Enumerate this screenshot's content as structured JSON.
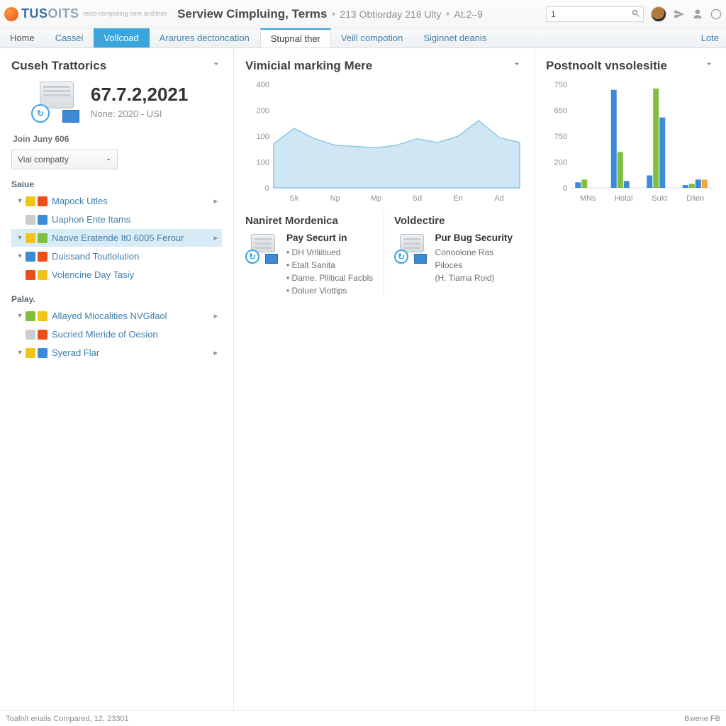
{
  "brand": {
    "part1": "TUS",
    "part2": "OITS",
    "subtitle": "telco computing nsm acdtines"
  },
  "breadcrumb": {
    "main": "Serview Cimpluing, Terms",
    "meta1": "213 Obtiorday 218 Ulty",
    "meta2": "At.2–9"
  },
  "search": {
    "value": "1"
  },
  "nav": {
    "items": [
      {
        "label": "Home"
      },
      {
        "label": "Cassel"
      },
      {
        "label": "Vollcoad"
      },
      {
        "label": "Ararures dectoncation"
      },
      {
        "label": "Stupnal ther"
      },
      {
        "label": "Veill compotion"
      },
      {
        "label": "Siginnet deanis"
      }
    ],
    "right": "Lote"
  },
  "left": {
    "title": "Cuseh Trattorics",
    "hero_number": "67.7.2,2021",
    "hero_sub": "None: 2020 - USI",
    "meta": "Join Juny 606",
    "select_value": "Vial compatty",
    "groups": [
      {
        "label": "Saiue",
        "items": [
          {
            "label": "Mapock Utles",
            "caret": true,
            "selected": false,
            "chev": true
          },
          {
            "label": "Uaphon Ente Itams",
            "caret": false,
            "selected": false,
            "chev": false
          },
          {
            "label": "Naove Eratende It0 6005 Ferour",
            "caret": true,
            "selected": true,
            "chev": true
          },
          {
            "label": "Duissand Toutlolution",
            "caret": true,
            "selected": false,
            "chev": false
          },
          {
            "label": "Volencine Day Tasiy",
            "caret": false,
            "selected": false,
            "chev": false
          }
        ]
      },
      {
        "label": "Palay.",
        "items": [
          {
            "label": "Allayed Miocalities NVGifaol",
            "caret": true,
            "selected": false,
            "chev": true
          },
          {
            "label": "Sucried Mleride of Oesion",
            "caret": false,
            "selected": false,
            "chev": false
          },
          {
            "label": "Syerad Flar",
            "caret": true,
            "selected": false,
            "chev": true
          }
        ]
      }
    ]
  },
  "center": {
    "title": "Vimicial marking Mere",
    "sub1": {
      "title": "Naniret Mordenica",
      "heading": "Pay Securt in",
      "lines": [
        "• DH Vrlliitiued",
        "• Etalt Sanita",
        "• Dame. Pllitical Facbls",
        "• Doluer Viottips"
      ]
    },
    "sub2": {
      "title": "Voldectire",
      "heading": "Pur Bug Security",
      "lines": [
        "Conoolone Ras Piloces",
        "(H. Tiama Roid)"
      ]
    }
  },
  "right": {
    "title": "Postnoolt vnsolesitie"
  },
  "footer": {
    "left": "Toafnlt enalis Compared, 12, 23301",
    "right": "Bwene FB"
  },
  "colors": {
    "area_fill": "#cfe7f4",
    "area_stroke": "#8fc6e4",
    "bar_blue": "#3d8bd6",
    "bar_green": "#7fbf3f",
    "bar_orange": "#f2a63c"
  },
  "chart_data": [
    {
      "type": "area",
      "title": "Vimicial marking Mere",
      "xlabel": "",
      "ylabel": "",
      "ylim": [
        0,
        400
      ],
      "y_ticks": [
        400,
        200,
        100,
        100,
        0
      ],
      "categories": [
        "Sk",
        "Np",
        "Mp",
        "Sd",
        "En",
        "Ad"
      ],
      "values": [
        170,
        230,
        190,
        165,
        160,
        155,
        165,
        190,
        175,
        200,
        260,
        195,
        175
      ]
    },
    {
      "type": "bar",
      "title": "Postnoolt vnsolesitie",
      "xlabel": "",
      "ylabel": "",
      "ylim": [
        0,
        750
      ],
      "y_ticks": [
        750,
        650,
        750,
        200,
        0
      ],
      "categories": [
        "MNs",
        "Hotal",
        "Sukt",
        "Dlien"
      ],
      "series": [
        {
          "name": "blue",
          "color": "#3d8bd6",
          "values": [
            40,
            710,
            90,
            20
          ]
        },
        {
          "name": "green",
          "color": "#7fbf3f",
          "values": [
            60,
            260,
            720,
            30
          ]
        },
        {
          "name": "blue2",
          "color": "#3d8bd6",
          "values": [
            0,
            50,
            510,
            60
          ]
        },
        {
          "name": "orange",
          "color": "#f2a63c",
          "values": [
            0,
            0,
            0,
            60
          ]
        }
      ]
    }
  ]
}
